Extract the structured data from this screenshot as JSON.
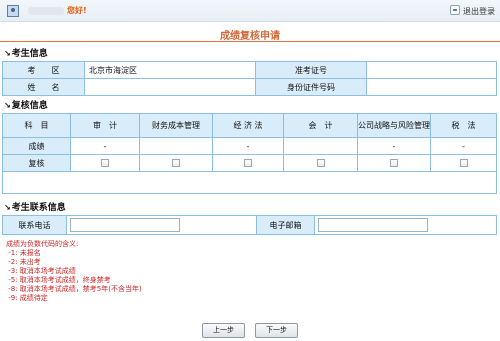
{
  "header": {
    "greeting": "您好!",
    "logout_label": "退出登录"
  },
  "page_title": "成绩复核申请",
  "candidate_info": {
    "section_title": "考生信息",
    "exam_area_label": "考　　区",
    "exam_area_value": "北京市海淀区",
    "admission_label": "准考证号",
    "name_label": "姓　　名",
    "id_label": "身份证件号码"
  },
  "review_info": {
    "section_title": "复核信息",
    "headers": [
      "科　目",
      "审　计",
      "财务成本管理",
      "经 济 法",
      "会　计",
      "公司战略与风险管理",
      "税　法"
    ],
    "score_label": "成绩",
    "review_label": "复核",
    "score_values": [
      "-",
      "",
      "-",
      "",
      "-",
      "-"
    ]
  },
  "contact_info": {
    "section_title": "考生联系信息",
    "phone_label": "联系电话",
    "email_label": "电子邮箱"
  },
  "notes": {
    "title": "成绩为负数代码的含义:",
    "items": [
      " -1: 未报名",
      " -2: 未出考",
      " -3: 取消本场考试成绩",
      " -5: 取消本场考试成绩，终身禁考",
      " -8: 取消本场考试成绩，禁考5年(不含当年)",
      " -9: 成绩待定"
    ]
  },
  "buttons": {
    "prev": "上一步",
    "next": "下一步"
  }
}
